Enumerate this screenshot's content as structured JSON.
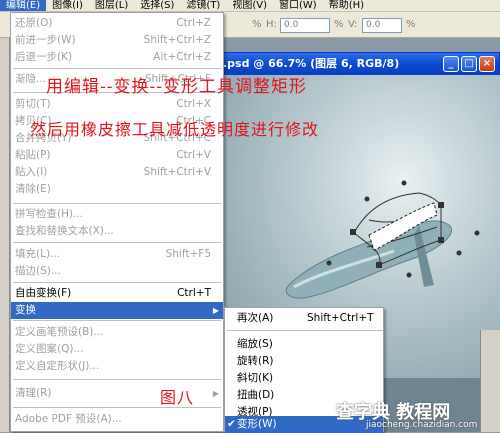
{
  "menubar": {
    "items": [
      {
        "label": "编辑(E)",
        "active": true
      },
      {
        "label": "图像(I)",
        "active": false
      },
      {
        "label": "图层(L)",
        "active": false
      },
      {
        "label": "选择(S)",
        "active": false
      },
      {
        "label": "滤镜(T)",
        "active": false
      },
      {
        "label": "视图(V)",
        "active": false
      },
      {
        "label": "窗口(W)",
        "active": false
      },
      {
        "label": "帮助(H)",
        "active": false
      }
    ]
  },
  "options": {
    "pct1": "%",
    "h_label": "H:",
    "h_value": "0.0",
    "pct2": "%",
    "v_label": "V:",
    "v_value": "0.0",
    "pct3": "%"
  },
  "document": {
    "title": ".psd @ 66.7% (图层 6, RGB/8)",
    "min_btn": "_",
    "max_btn": "□",
    "close_btn": "×"
  },
  "edit_menu": {
    "items": [
      {
        "label": "还原(O)",
        "shortcut": "Ctrl+Z",
        "disabled": true
      },
      {
        "label": "前进一步(W)",
        "shortcut": "Shift+Ctrl+Z",
        "disabled": true
      },
      {
        "label": "后退一步(K)",
        "shortcut": "Alt+Ctrl+Z",
        "disabled": true
      },
      {
        "label": "渐隐...",
        "shortcut": "Shift+Ctrl+F",
        "disabled": true
      },
      {
        "label": "剪切(T)",
        "shortcut": "Ctrl+X",
        "disabled": true
      },
      {
        "label": "拷贝(C)",
        "shortcut": "Ctrl+C",
        "disabled": true
      },
      {
        "label": "合并拷贝(Y)",
        "shortcut": "Shift+Ctrl+C",
        "disabled": true
      },
      {
        "label": "粘贴(P)",
        "shortcut": "Ctrl+V",
        "disabled": true
      },
      {
        "label": "贴入(I)",
        "shortcut": "Shift+Ctrl+V",
        "disabled": true
      },
      {
        "label": "清除(E)",
        "shortcut": "",
        "disabled": true
      },
      {
        "label": "拼写检查(H)...",
        "shortcut": "",
        "disabled": true
      },
      {
        "label": "查找和替换文本(X)...",
        "shortcut": "",
        "disabled": true
      },
      {
        "label": "填充(L)...",
        "shortcut": "Shift+F5",
        "disabled": true
      },
      {
        "label": "描边(S)...",
        "shortcut": "",
        "disabled": true
      },
      {
        "label": "自由变换(F)",
        "shortcut": "Ctrl+T",
        "disabled": false
      },
      {
        "label": "变换",
        "shortcut": "",
        "disabled": false,
        "submenu": true
      },
      {
        "label": "定义画笔预设(B)...",
        "shortcut": "",
        "disabled": true
      },
      {
        "label": "定义图案(Q)...",
        "shortcut": "",
        "disabled": true
      },
      {
        "label": "定义自定形状(J)...",
        "shortcut": "",
        "disabled": true
      },
      {
        "label": "清理(R)",
        "shortcut": "",
        "disabled": true,
        "submenu": true
      },
      {
        "label": "Adobe PDF 预设(A)...",
        "shortcut": "",
        "disabled": true
      }
    ],
    "submenu_arrow": "▶"
  },
  "transform_submenu": {
    "items": [
      {
        "label": "再次(A)",
        "shortcut": "Shift+Ctrl+T"
      },
      {
        "label": "缩放(S)",
        "shortcut": ""
      },
      {
        "label": "旋转(R)",
        "shortcut": ""
      },
      {
        "label": "斜切(K)",
        "shortcut": ""
      },
      {
        "label": "扭曲(D)",
        "shortcut": ""
      },
      {
        "label": "透视(P)",
        "shortcut": ""
      },
      {
        "label": "变形(W)",
        "shortcut": "",
        "checked": true
      }
    ],
    "check_mark": "✔"
  },
  "annotations": {
    "line1": "用编辑--变换--变形工具调整矩形",
    "line2": "然后用橡皮擦工具减低透明度进行修改",
    "figure_label": "图八",
    "color": "#e0141c"
  },
  "watermark": {
    "main": "查字典 教程网",
    "url": "jiaocheng.chazidian.com"
  }
}
